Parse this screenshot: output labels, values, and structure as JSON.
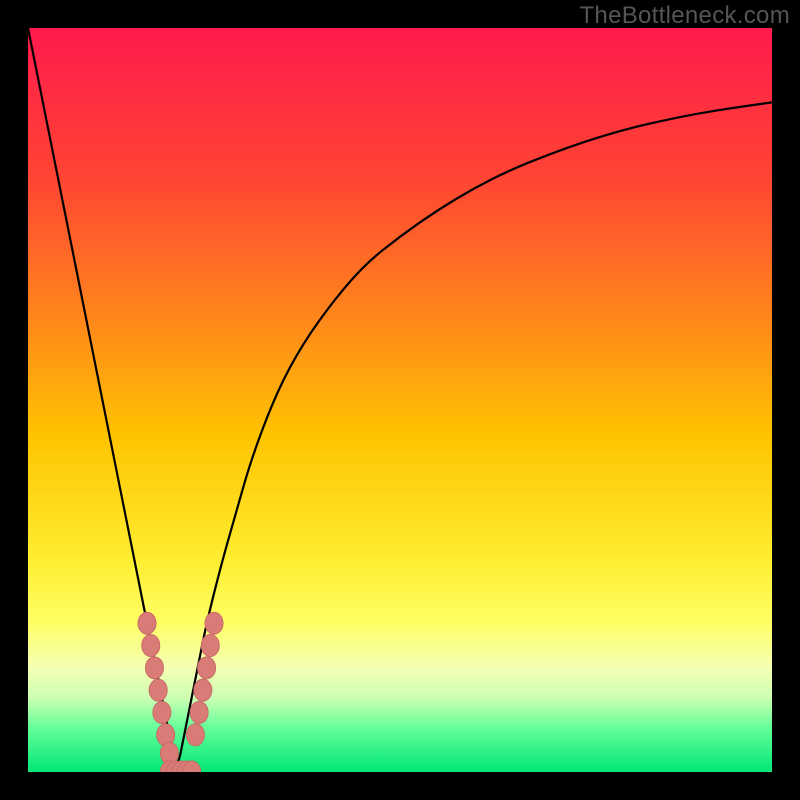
{
  "watermark": "TheBottleneck.com",
  "colors": {
    "frame": "#000000",
    "curve": "#000000",
    "marker_fill": "#d97c78",
    "marker_stroke": "#c96a66",
    "gradient_stops": [
      {
        "offset": 0.0,
        "color": "#ff1a4d"
      },
      {
        "offset": 0.2,
        "color": "#ff4433"
      },
      {
        "offset": 0.4,
        "color": "#ff8a1a"
      },
      {
        "offset": 0.55,
        "color": "#ffc400"
      },
      {
        "offset": 0.72,
        "color": "#ffef33"
      },
      {
        "offset": 0.8,
        "color": "#ffff66"
      },
      {
        "offset": 0.86,
        "color": "#f4ffb3"
      },
      {
        "offset": 0.9,
        "color": "#ccffb3"
      },
      {
        "offset": 0.94,
        "color": "#66ff99"
      },
      {
        "offset": 1.0,
        "color": "#00e676"
      }
    ]
  },
  "chart_data": {
    "type": "line",
    "title": "",
    "xlabel": "",
    "ylabel": "",
    "xlim": [
      0,
      100
    ],
    "ylim": [
      0,
      100
    ],
    "x_optimum": 20,
    "series": [
      {
        "name": "bottleneck-curve",
        "x": [
          0,
          2,
          4,
          6,
          8,
          10,
          12,
          14,
          16,
          17,
          18,
          19,
          20,
          21,
          22,
          23,
          24,
          26,
          28,
          30,
          33,
          36,
          40,
          45,
          50,
          55,
          60,
          65,
          70,
          75,
          80,
          85,
          90,
          95,
          100
        ],
        "y": [
          100,
          90,
          80,
          70,
          60,
          50,
          40,
          30,
          20,
          15,
          10,
          5,
          0,
          5,
          10,
          15,
          20,
          28,
          35,
          42,
          50,
          56,
          62,
          68,
          72,
          75.5,
          78.5,
          81,
          83,
          84.8,
          86.3,
          87.5,
          88.5,
          89.3,
          90
        ]
      }
    ],
    "markers": {
      "name": "sample-points",
      "points": [
        {
          "x": 16.0,
          "y": 20
        },
        {
          "x": 16.5,
          "y": 17
        },
        {
          "x": 17.0,
          "y": 14
        },
        {
          "x": 17.5,
          "y": 11
        },
        {
          "x": 18.0,
          "y": 8
        },
        {
          "x": 18.5,
          "y": 5
        },
        {
          "x": 19.0,
          "y": 2.5
        },
        {
          "x": 19.0,
          "y": 0
        },
        {
          "x": 19.8,
          "y": 0
        },
        {
          "x": 20.6,
          "y": 0
        },
        {
          "x": 21.3,
          "y": 0
        },
        {
          "x": 22.0,
          "y": 0
        },
        {
          "x": 22.5,
          "y": 5
        },
        {
          "x": 23.0,
          "y": 8
        },
        {
          "x": 23.5,
          "y": 11
        },
        {
          "x": 24.0,
          "y": 14
        },
        {
          "x": 24.5,
          "y": 17
        },
        {
          "x": 25.0,
          "y": 20
        }
      ]
    }
  }
}
